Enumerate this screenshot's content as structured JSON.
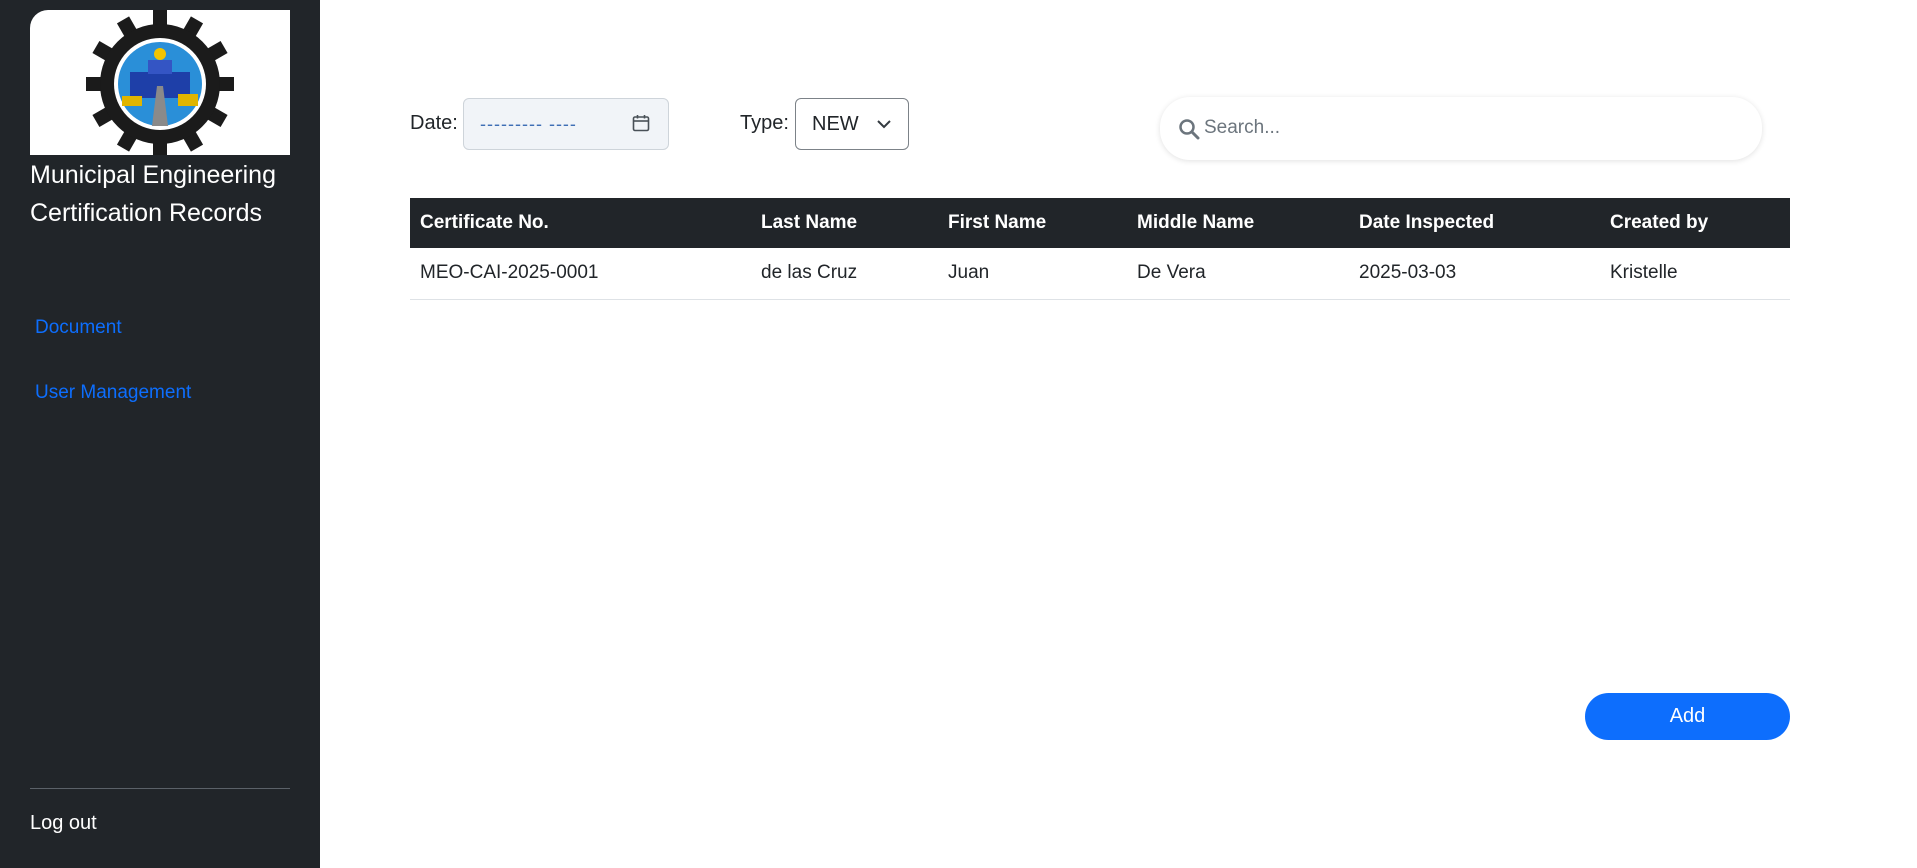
{
  "sidebar": {
    "logo_icon": "municipal-engineering-office-seal",
    "title": "Municipal Engineering Certification Records",
    "nav": [
      {
        "label": "Document"
      },
      {
        "label": "User Management"
      }
    ],
    "logout_label": "Log out"
  },
  "filters": {
    "date_label": "Date:",
    "date_value": "--------- ----",
    "type_label": "Type:",
    "type_value": "NEW"
  },
  "search": {
    "placeholder": "Search...",
    "value": ""
  },
  "table": {
    "columns": [
      "Certificate No.",
      "Last Name",
      "First Name",
      "Middle Name",
      "Date Inspected",
      "Created by"
    ],
    "rows": [
      [
        "MEO-CAI-2025-0001",
        "de las Cruz",
        "Juan",
        "De Vera",
        "2025-03-03",
        "Kristelle"
      ]
    ]
  },
  "actions": {
    "add_label": "Add"
  },
  "colors": {
    "sidebar_bg": "#212529",
    "accent": "#0d6efd",
    "table_header_bg": "#212529"
  }
}
